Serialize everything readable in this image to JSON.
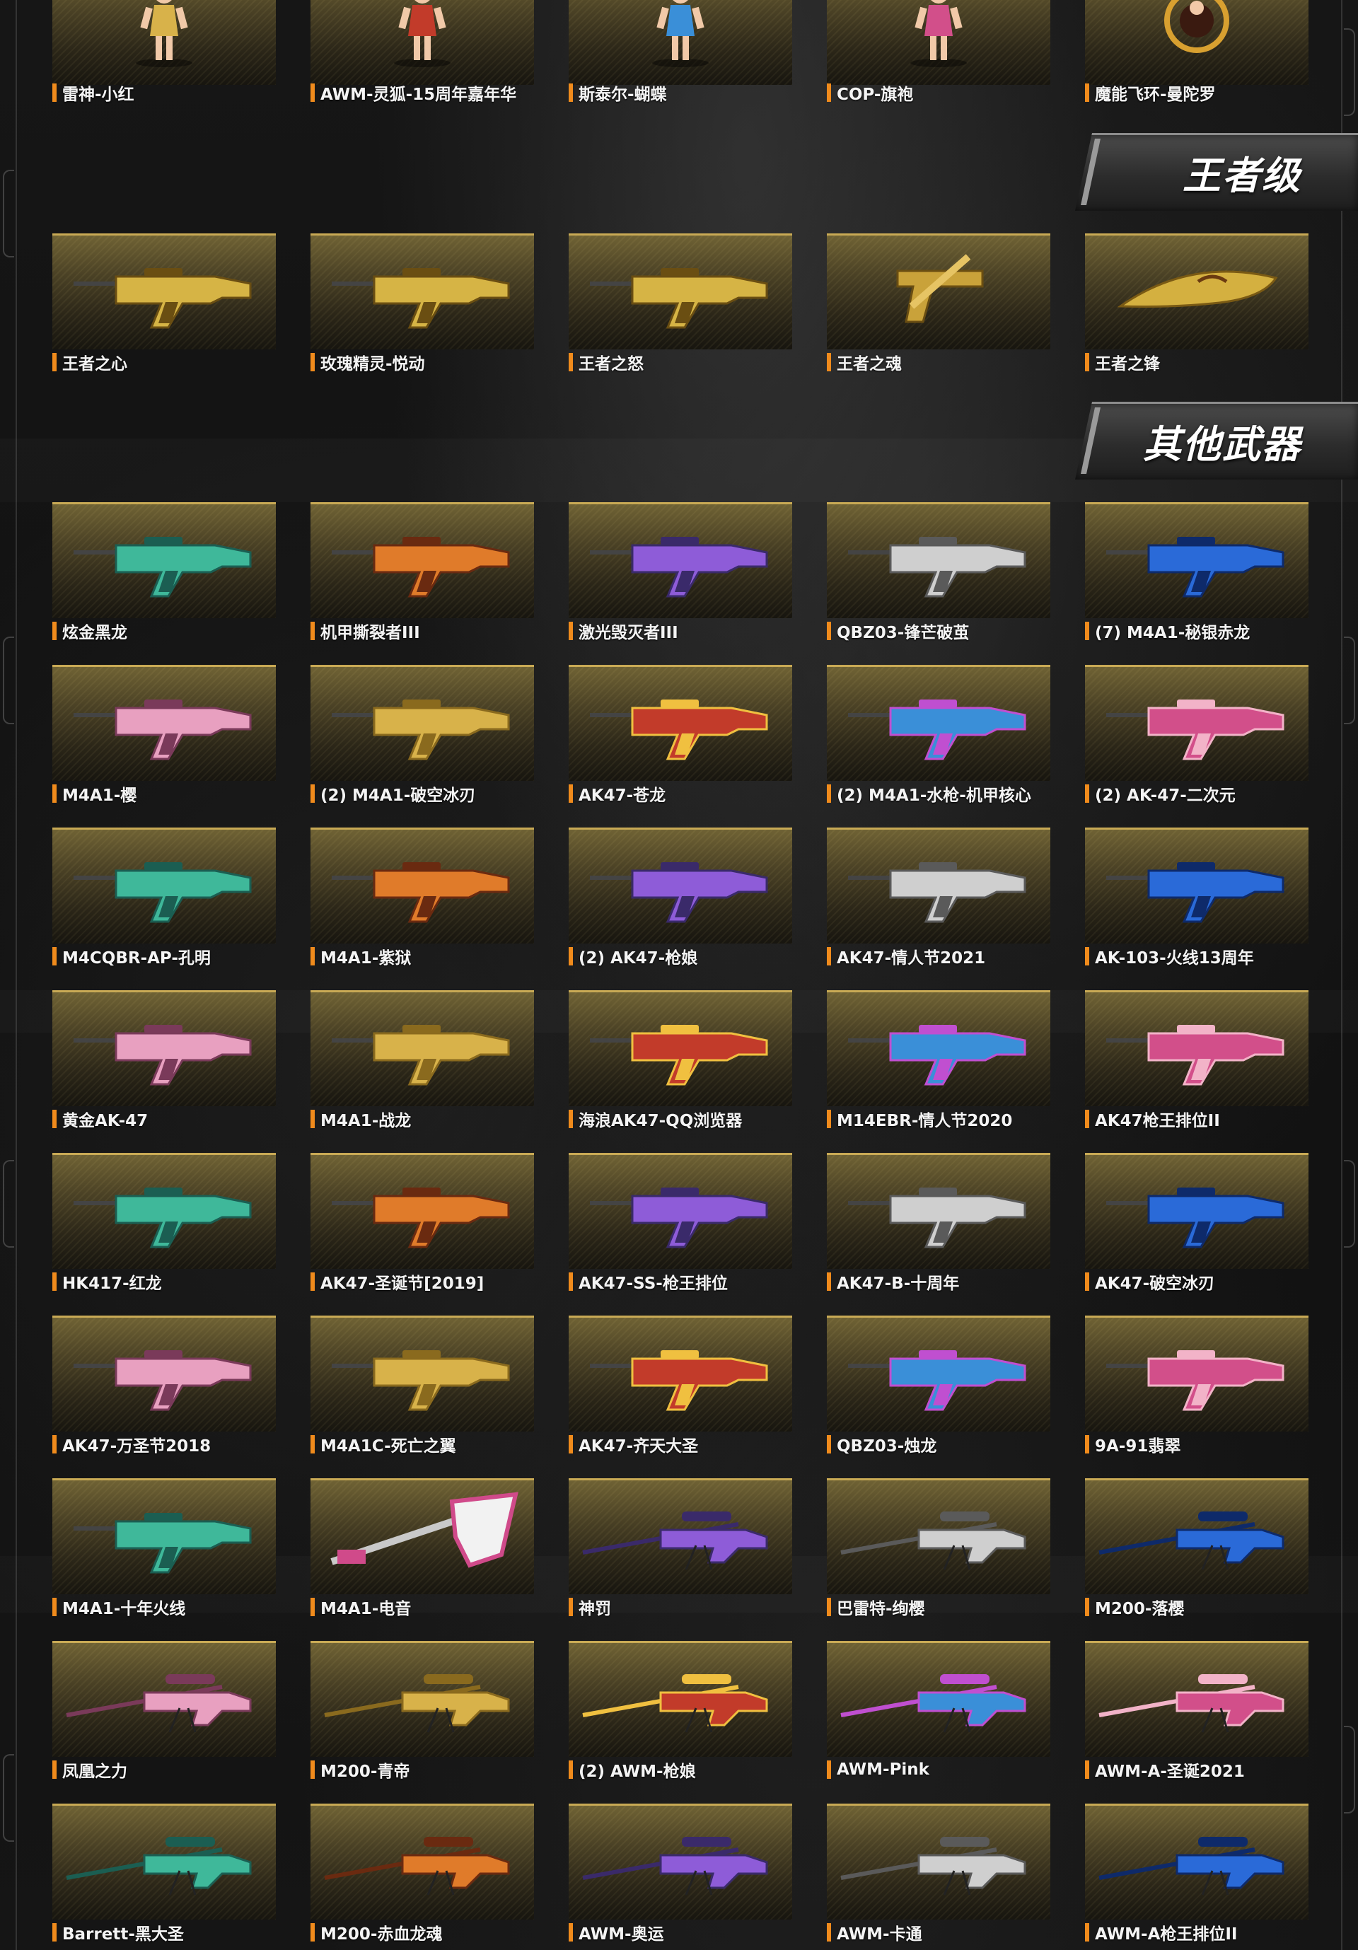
{
  "sections": [
    {
      "id": "top",
      "title": "",
      "items": [
        {
          "label": "雷神-小红",
          "icon": "character-figure-icon"
        },
        {
          "label": "AWM-灵狐-15周年嘉年华",
          "icon": "character-figure-icon"
        },
        {
          "label": "斯泰尔-蝴蝶",
          "icon": "character-figure-icon"
        },
        {
          "label": "COP-旗袍",
          "icon": "character-figure-icon"
        },
        {
          "label": "魔能飞环-曼陀罗",
          "icon": "ring-blade-icon"
        }
      ]
    },
    {
      "id": "king",
      "title": "王者级",
      "items": [
        {
          "label": "王者之心",
          "icon": "golden-rifle-icon"
        },
        {
          "label": "玫瑰精灵-悦动",
          "icon": "golden-rifle-icon"
        },
        {
          "label": "王者之怒",
          "icon": "golden-rifle-icon"
        },
        {
          "label": "王者之魂",
          "icon": "golden-pistol-icon"
        },
        {
          "label": "王者之锋",
          "icon": "golden-blade-icon"
        }
      ]
    },
    {
      "id": "other",
      "title": "其他武器",
      "items": [
        {
          "label": "炫金黑龙",
          "icon": "rifle-icon"
        },
        {
          "label": "机甲撕裂者III",
          "icon": "rifle-icon"
        },
        {
          "label": "激光毁灭者III",
          "icon": "rifle-icon"
        },
        {
          "label": "QBZ03-锋芒破茧",
          "icon": "rifle-icon"
        },
        {
          "label": "(7) M4A1-秘银赤龙",
          "icon": "rifle-icon"
        },
        {
          "label": "M4A1-樱",
          "icon": "rifle-icon"
        },
        {
          "label": "(2) M4A1-破空冰刃",
          "icon": "rifle-icon"
        },
        {
          "label": "AK47-苍龙",
          "icon": "rifle-icon"
        },
        {
          "label": "(2) M4A1-水枪-机甲核心",
          "icon": "rifle-icon"
        },
        {
          "label": "(2) AK-47-二次元",
          "icon": "rifle-icon"
        },
        {
          "label": "M4CQBR-AP-孔明",
          "icon": "rifle-icon"
        },
        {
          "label": "M4A1-紫狱",
          "icon": "rifle-icon"
        },
        {
          "label": "(2) AK47-枪娘",
          "icon": "rifle-icon"
        },
        {
          "label": "AK47-情人节2021",
          "icon": "rifle-icon"
        },
        {
          "label": "AK-103-火线13周年",
          "icon": "rifle-icon"
        },
        {
          "label": "黄金AK-47",
          "icon": "rifle-icon"
        },
        {
          "label": "M4A1-战龙",
          "icon": "rifle-icon"
        },
        {
          "label": "海浪AK47-QQ浏览器",
          "icon": "rifle-icon"
        },
        {
          "label": "M14EBR-情人节2020",
          "icon": "rifle-icon"
        },
        {
          "label": "AK47枪王排位II",
          "icon": "rifle-icon"
        },
        {
          "label": "HK417-红龙",
          "icon": "rifle-icon"
        },
        {
          "label": "AK47-圣诞节[2019]",
          "icon": "rifle-icon"
        },
        {
          "label": "AK47-SS-枪王排位",
          "icon": "rifle-icon"
        },
        {
          "label": "AK47-B-十周年",
          "icon": "rifle-icon"
        },
        {
          "label": "AK47-破空冰刃",
          "icon": "rifle-icon"
        },
        {
          "label": "AK47-万圣节2018",
          "icon": "rifle-icon"
        },
        {
          "label": "M4A1C-死亡之翼",
          "icon": "rifle-icon"
        },
        {
          "label": "AK47-齐天大圣",
          "icon": "rifle-icon"
        },
        {
          "label": "QBZ03-烛龙",
          "icon": "rifle-icon"
        },
        {
          "label": "9A-91翡翠",
          "icon": "rifle-icon"
        },
        {
          "label": "M4A1-十年火线",
          "icon": "rifle-icon"
        },
        {
          "label": "M4A1-电音",
          "icon": "guitar-rifle-icon"
        },
        {
          "label": "神罚",
          "icon": "sniper-rifle-icon"
        },
        {
          "label": "巴雷特-绚樱",
          "icon": "sniper-rifle-icon"
        },
        {
          "label": "M200-落樱",
          "icon": "sniper-rifle-icon"
        },
        {
          "label": "凤凰之力",
          "icon": "sniper-rifle-icon"
        },
        {
          "label": "M200-青帝",
          "icon": "sniper-rifle-icon"
        },
        {
          "label": "(2) AWM-枪娘",
          "icon": "sniper-rifle-icon"
        },
        {
          "label": "AWM-Pink",
          "icon": "sniper-rifle-icon"
        },
        {
          "label": "AWM-A-圣诞2021",
          "icon": "sniper-rifle-icon"
        },
        {
          "label": "Barrett-黑大圣",
          "icon": "sniper-rifle-icon"
        },
        {
          "label": "M200-赤血龙魂",
          "icon": "sniper-rifle-icon"
        },
        {
          "label": "AWM-奥运",
          "icon": "sniper-rifle-icon"
        },
        {
          "label": "AWM-卡通",
          "icon": "sniper-rifle-icon"
        },
        {
          "label": "AWM-A枪王排位II",
          "icon": "sniper-rifle-icon"
        }
      ]
    }
  ],
  "colors": {
    "label_accent": "#f08b1c",
    "card_top_border": "#c9aa55",
    "card_gold": "#6f6234"
  }
}
